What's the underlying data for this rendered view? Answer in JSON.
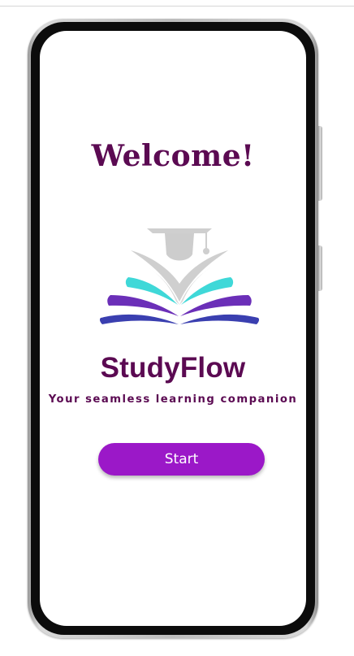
{
  "screen": {
    "welcome_title": "Welcome!",
    "app_name": "StudyFlow",
    "tagline": "Your seamless learning companion",
    "start_button_label": "Start"
  },
  "logo": {
    "icon": "graduation-cap-open-book-logo",
    "colors": {
      "cap": "#d2d2d2",
      "teal": "#3fd8d8",
      "purple": "#6b2fb8",
      "blue": "#3a3fb0"
    }
  },
  "colors": {
    "title": "#5b0a52",
    "button": "#9b18c8",
    "button_text": "#ffffff"
  }
}
